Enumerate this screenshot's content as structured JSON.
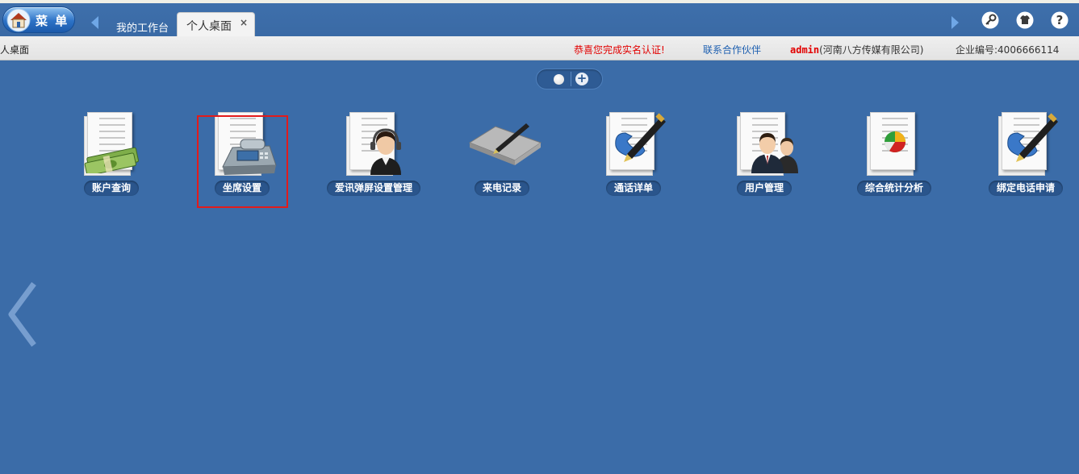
{
  "topbar": {
    "menu_label": "菜 单",
    "tabs": [
      {
        "label": "我的工作台"
      },
      {
        "label": "个人桌面",
        "close": "×"
      }
    ]
  },
  "infobar": {
    "breadcrumb": "人桌面",
    "congrats": "恭喜您完成实名认证!",
    "partner_link": "联系合作伙伴",
    "user": "admin",
    "company": "(河南八方传媒有限公司)",
    "corp_id": "企业编号:4006666114"
  },
  "pager": {
    "plus": "+"
  },
  "apps": [
    {
      "label": "账户查询",
      "icon": "money-stack-icon"
    },
    {
      "label": "坐席设置",
      "icon": "telephone-icon"
    },
    {
      "label": "爱讯弹屏设置管理",
      "icon": "headset-agent-icon"
    },
    {
      "label": "来电记录",
      "icon": "folder-pen-icon"
    },
    {
      "label": "通话详单",
      "icon": "phone-pen-icon"
    },
    {
      "label": "用户管理",
      "icon": "users-icon"
    },
    {
      "label": "综合统计分析",
      "icon": "pie-chart-icon"
    },
    {
      "label": "绑定电话申请",
      "icon": "phone-pen-icon"
    }
  ],
  "colors": {
    "background": "#3b6ca8",
    "highlight": "#e21b1b",
    "alert_text": "#e20000",
    "link": "#1d5fb0"
  }
}
